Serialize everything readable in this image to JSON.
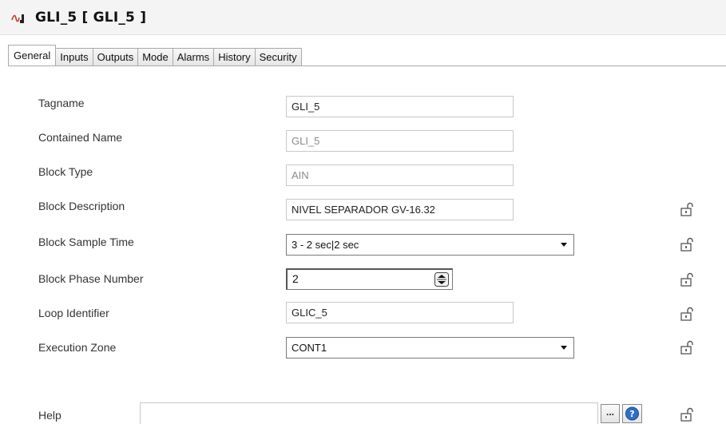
{
  "header": {
    "title": "GLI_5 [ GLI_5 ]",
    "icon": "block-signal-icon",
    "icon_color": "#c0392b"
  },
  "tabs": [
    {
      "label": "General",
      "active": true
    },
    {
      "label": "Inputs"
    },
    {
      "label": "Outputs"
    },
    {
      "label": "Mode"
    },
    {
      "label": "Alarms"
    },
    {
      "label": "History"
    },
    {
      "label": "Security"
    }
  ],
  "form": {
    "tagname": {
      "label": "Tagname",
      "value": "GLI_5"
    },
    "contained_name": {
      "label": "Contained Name",
      "value": "GLI_5"
    },
    "block_type": {
      "label": "Block Type",
      "value": "AIN"
    },
    "block_description": {
      "label": "Block Description",
      "value": "NIVEL SEPARADOR GV-16.32"
    },
    "block_sample_time": {
      "label": "Block Sample Time",
      "value": "3 - 2 sec|2 sec"
    },
    "block_phase_number": {
      "label": "Block Phase Number",
      "value": "2"
    },
    "loop_identifier": {
      "label": "Loop Identifier",
      "value": "GLIC_5"
    },
    "execution_zone": {
      "label": "Execution Zone",
      "value": "CONT1"
    },
    "help": {
      "label": "Help",
      "value": "",
      "browse_label": "..."
    }
  },
  "icons": {
    "lock": "unlock-padlock-icon",
    "help": "question-help-icon",
    "spinner": "spin-updown-icon"
  }
}
